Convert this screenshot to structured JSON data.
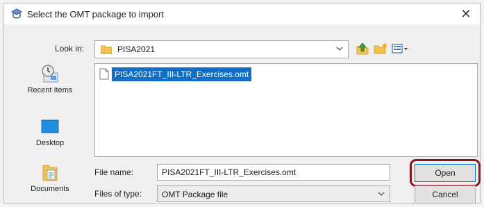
{
  "dialog": {
    "title": "Select the OMT package to import",
    "close_glyph": "✕"
  },
  "lookin": {
    "label": "Look in:",
    "value": "PISA2021"
  },
  "toolbar": {
    "icons": [
      "up-folder-icon",
      "new-folder-icon",
      "view-menu-icon"
    ]
  },
  "places": [
    {
      "label": "Recent Items",
      "icon": "recent-items-icon"
    },
    {
      "label": "Desktop",
      "icon": "desktop-icon"
    },
    {
      "label": "Documents",
      "icon": "documents-icon"
    }
  ],
  "files": [
    {
      "name": "PISA2021FT_III-LTR_Exercises.omt",
      "selected": true
    }
  ],
  "form": {
    "file_name_label": "File name:",
    "file_name_value": "PISA2021FT_III-LTR_Exercises.omt",
    "file_type_label": "Files of type:",
    "file_type_value": "OMT Package file"
  },
  "buttons": {
    "open": "Open",
    "cancel": "Cancel"
  },
  "colors": {
    "selection": "#0f6fc6",
    "highlight_ring": "#8a1522",
    "folder": "#f2c14e"
  }
}
